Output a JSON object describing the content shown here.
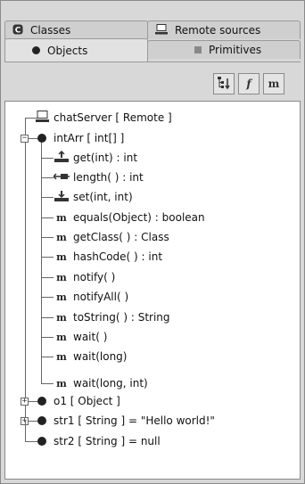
{
  "tabs": {
    "row_back": [
      {
        "label": "Classes",
        "icon": "class-icon"
      },
      {
        "label": "Remote sources",
        "icon": "computer-icon"
      }
    ],
    "row_front": [
      {
        "label": "Objects",
        "icon": "object-dot-icon",
        "active": true
      },
      {
        "label": "Primitives",
        "icon": "primitive-square-icon",
        "active": false
      }
    ]
  },
  "toolbar": {
    "buttons": [
      {
        "icon": "sort-tree-icon"
      },
      {
        "icon": "field-f-icon",
        "glyph": "f"
      },
      {
        "icon": "method-m-icon",
        "glyph": "m"
      }
    ]
  },
  "tree": {
    "chatServer": "chatServer  [ Remote ]",
    "intArr": "intArr  [ int[] ]",
    "methods": [
      {
        "label": "get(int) : int",
        "icon": "getter-icon"
      },
      {
        "label": "length( ) : int",
        "icon": "length-icon"
      },
      {
        "label": "set(int, int)",
        "icon": "setter-icon"
      },
      {
        "label": "equals(Object) : boolean",
        "icon": "method-m-icon"
      },
      {
        "label": "getClass( ) : Class",
        "icon": "method-m-icon"
      },
      {
        "label": "hashCode( ) : int",
        "icon": "method-m-icon"
      },
      {
        "label": "notify( )",
        "icon": "method-m-icon"
      },
      {
        "label": "notifyAll( )",
        "icon": "method-m-icon"
      },
      {
        "label": "toString( ) : String",
        "icon": "method-m-icon"
      },
      {
        "label": "wait( )",
        "icon": "method-m-icon"
      },
      {
        "label": "wait(long)",
        "icon": "method-m-icon"
      },
      {
        "label": "wait(long, int)",
        "icon": "method-m-icon"
      }
    ],
    "o1": "o1  [ Object ]",
    "str1": "str1  [ String ]  =  \"Hello world!\"",
    "str2": "str2  [ String ]  =  null",
    "m_glyph": "m",
    "expand_plus": "+",
    "expand_minus": "−"
  }
}
